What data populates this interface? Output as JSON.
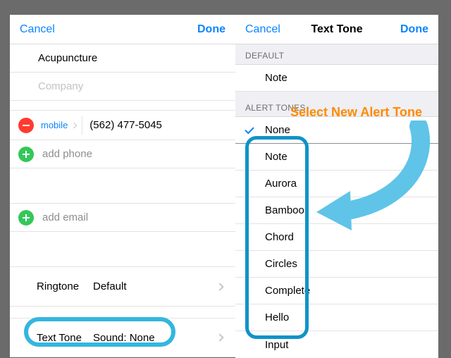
{
  "left": {
    "header": {
      "cancel": "Cancel",
      "done": "Done"
    },
    "company_name": "Acupuncture",
    "company_placeholder": "Company",
    "phone": {
      "label": "mobile",
      "value": "(562) 477-5045"
    },
    "add_phone": "add phone",
    "add_email": "add email",
    "ringtone": {
      "label": "Ringtone",
      "value": "Default"
    },
    "texttone": {
      "label": "Text Tone",
      "value": "Sound: None"
    }
  },
  "right": {
    "header": {
      "cancel": "Cancel",
      "title": "Text Tone",
      "done": "Done"
    },
    "section_default": "DEFAULT",
    "default_value": "Note",
    "section_alert": "ALERT TONES",
    "selected": "None",
    "tones": [
      "Note",
      "Aurora",
      "Bamboo",
      "Chord",
      "Circles",
      "Complete",
      "Hello",
      "Input"
    ]
  },
  "annotation": {
    "instruction": "Select New Alert Tone",
    "arrow_color": "#5fc4e8",
    "highlight_color": "#34b6df"
  }
}
